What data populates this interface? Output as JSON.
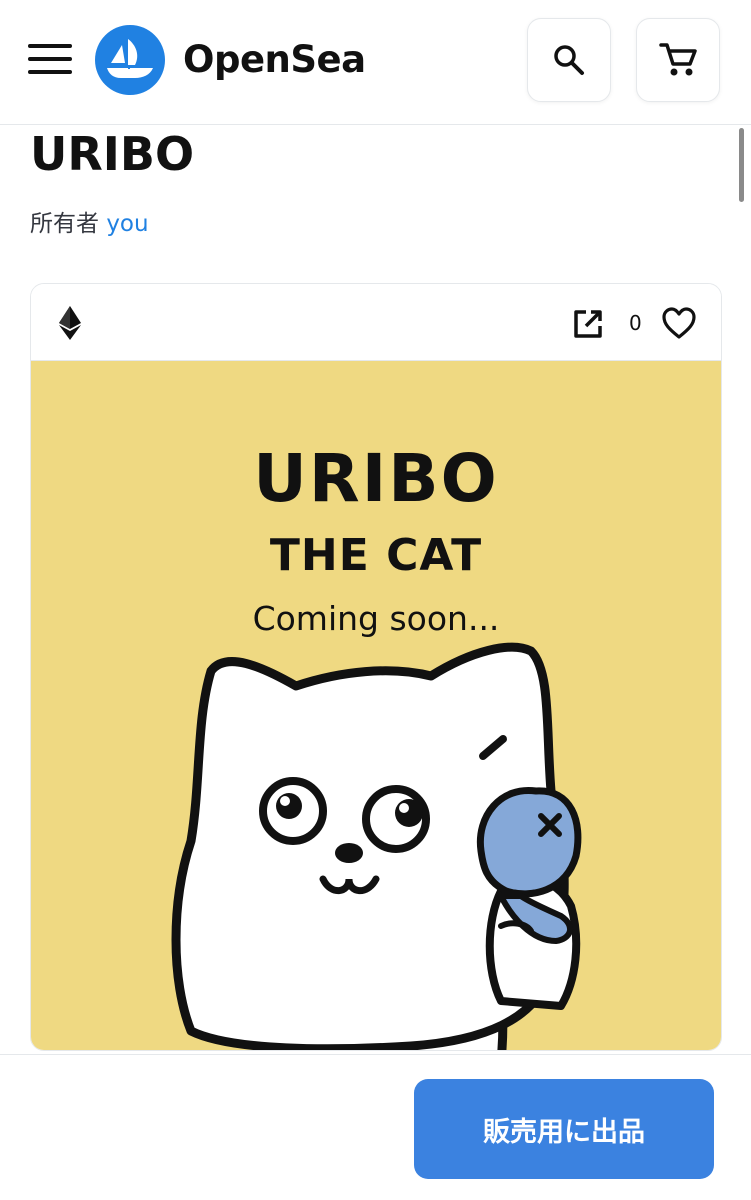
{
  "header": {
    "brand": "OpenSea",
    "brand_color": "#2081e2",
    "menu_icon": "hamburger-menu-icon",
    "logo_icon": "opensea-ship-logo",
    "search_icon": "search-icon",
    "cart_icon": "cart-icon"
  },
  "item": {
    "title": "URIBO",
    "owner_label": "所有者",
    "owner_link": "you",
    "favorites_count": "0"
  },
  "card": {
    "chain_icon": "ethereum-icon",
    "external_link_icon": "external-link-icon",
    "favorite_icon": "heart-outline-icon"
  },
  "artwork": {
    "line1": "URIBO",
    "line2": "THE CAT",
    "line3": "Coming soon...",
    "background_color": "#efd982"
  },
  "actions": {
    "sell_button": "販売用に出品",
    "sell_button_color": "#3b82e0"
  }
}
